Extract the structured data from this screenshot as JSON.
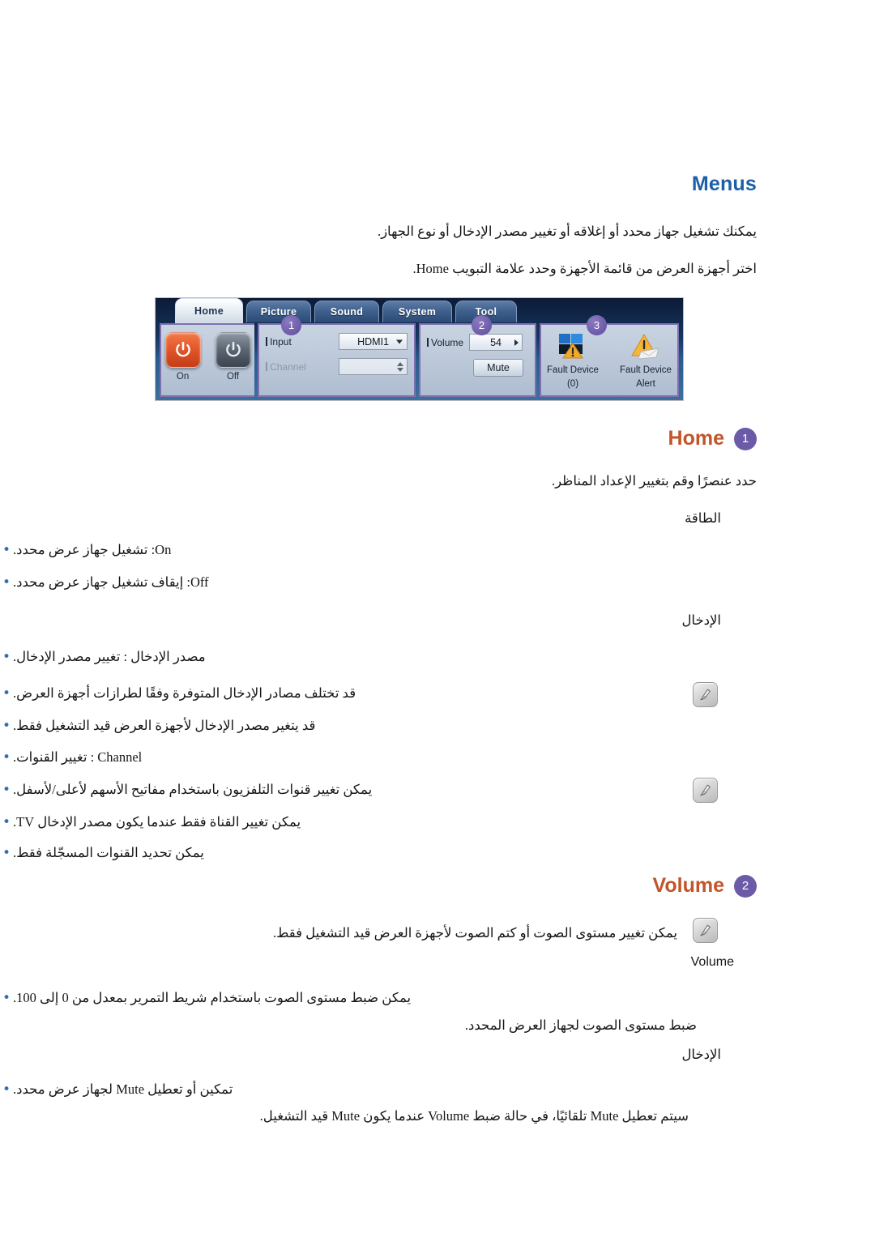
{
  "doc": {
    "menus_heading": "Menus",
    "intro_line1": "يمكنك تشغيل جهاز محدد أو إغلاقه أو تغيير مصدر الإدخال أو نوع الجهاز.",
    "intro_line2": "اختر أجهزة العرض من قائمة الأجهزة وحدد علامة التبويب Home."
  },
  "screenshot": {
    "tabs": [
      {
        "label": "Home",
        "active": true
      },
      {
        "label": "Picture",
        "active": false
      },
      {
        "label": "Sound",
        "active": false
      },
      {
        "label": "System",
        "active": false
      },
      {
        "label": "Tool",
        "active": false
      }
    ],
    "power": {
      "on_label": "On",
      "off_label": "Off"
    },
    "input_panel": {
      "badge": "1",
      "input_label": "Input",
      "input_value": "HDMI1",
      "channel_label": "Channel",
      "channel_value": ""
    },
    "volume_panel": {
      "badge": "2",
      "volume_label": "Volume",
      "volume_value": "54",
      "mute_label": "Mute"
    },
    "fault_panel": {
      "badge": "3",
      "fault_device_line1": "Fault Device",
      "fault_device_line2": "(0)",
      "fault_alert_line1": "Fault Device",
      "fault_alert_line2": "Alert"
    }
  },
  "home_section": {
    "title": "Home",
    "badge": "1",
    "lead": "حدد عنصرًا وقم بتغيير الإعداد المناظر.",
    "power_group_title": "الطاقة",
    "power_items": [
      "On: تشغيل جهاز عرض محدد.",
      "Off: إيقاف تشغيل جهاز عرض محدد."
    ],
    "input_group_title": "الإدخال",
    "input_items": [
      "مصدر الإدخال : تغيير مصدر الإدخال."
    ],
    "input_notes": [
      "قد تختلف مصادر الإدخال المتوفرة وفقًا لطرازات أجهزة العرض.",
      "قد يتغير مصدر الإدخال لأجهزة العرض قيد التشغيل فقط."
    ],
    "channel_items": [
      "Channel : تغيير القنوات."
    ],
    "channel_notes": [
      "يمكن تغيير قنوات التلفزيون باستخدام مفاتيح الأسهم لأعلى/لأسفل.",
      "يمكن تغيير القناة فقط عندما يكون مصدر الإدخال TV.",
      "يمكن تحديد القنوات المسجّلة فقط."
    ]
  },
  "volume_section": {
    "title": "Volume",
    "badge": "2",
    "note": "يمكن تغيير مستوى الصوت أو كتم الصوت لأجهزة العرض قيد التشغيل فقط.",
    "group_title": "Volume",
    "items": [
      "يمكن ضبط مستوى الصوت باستخدام شريط التمرير بمعدل من 0 إلى 100.",
      "ضبط مستوى الصوت لجهاز العرض المحدد."
    ],
    "input_group_title": "الإدخال",
    "mute_items": [
      "تمكين أو تعطيل Mute لجهاز عرض محدد.",
      "سيتم تعطيل Mute تلقائيًا، في حالة ضبط Volume عندما يكون Mute قيد التشغيل."
    ]
  },
  "colors": {
    "menus_heading": "#1c5fa8",
    "section_heading": "#c2552a",
    "badge": "#6b5aa8",
    "bullet": "#2f6fb5",
    "power_on": "#e2562a",
    "power_off": "#5c6773"
  },
  "icons": {
    "note": "note-pencil-icon",
    "fault_device": "fault-device-icon",
    "fault_alert": "fault-alert-icon"
  }
}
